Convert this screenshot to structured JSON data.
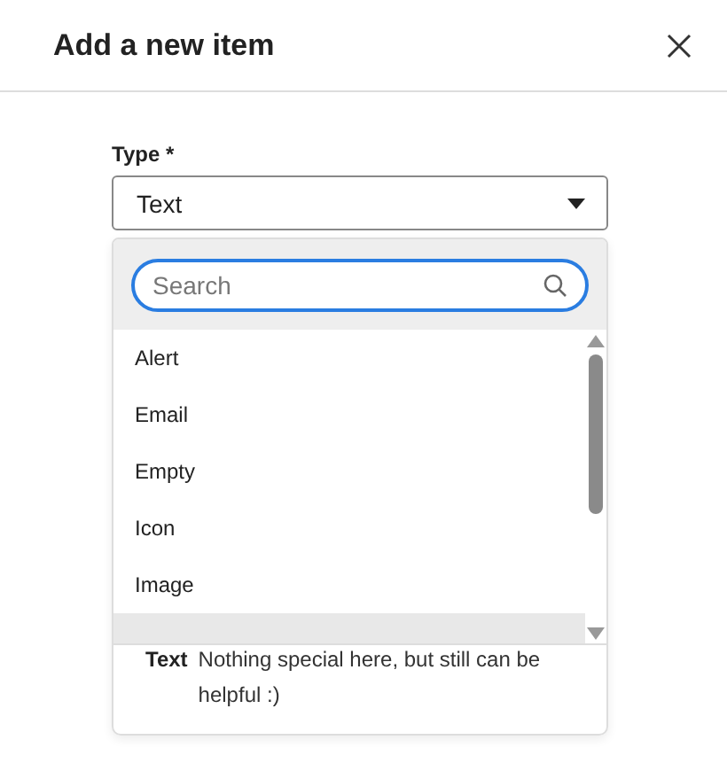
{
  "dialog": {
    "title": "Add a new item"
  },
  "type_field": {
    "label": "Type *",
    "value": "Text"
  },
  "dropdown": {
    "search": {
      "placeholder": "Search"
    },
    "options": [
      {
        "label": "Alert",
        "hovered": false
      },
      {
        "label": "Email",
        "hovered": false
      },
      {
        "label": "Empty",
        "hovered": false
      },
      {
        "label": "Icon",
        "hovered": false
      },
      {
        "label": "Image",
        "hovered": false
      }
    ],
    "partial_row_hovered": true
  },
  "description": {
    "name": "Text",
    "text": "Nothing special here, but still can be helpful :)"
  }
}
